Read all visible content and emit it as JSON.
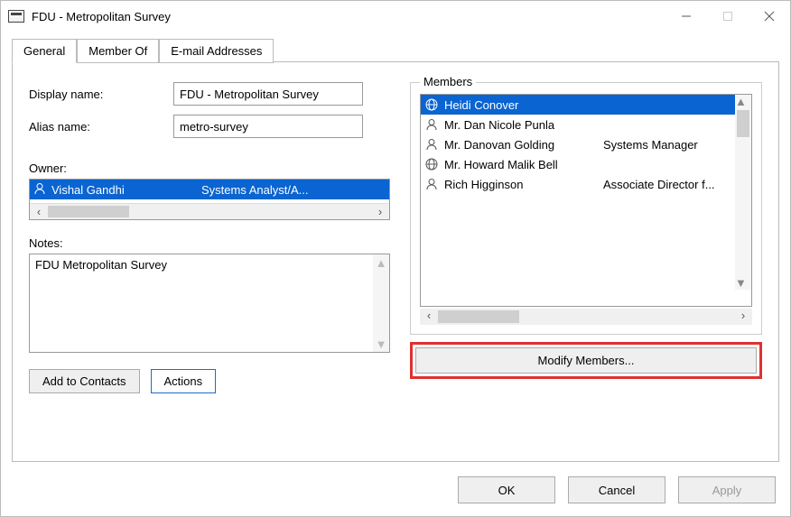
{
  "window": {
    "title": "FDU - Metropolitan Survey"
  },
  "tabs": [
    {
      "label": "General",
      "active": true
    },
    {
      "label": "Member Of",
      "active": false
    },
    {
      "label": "E-mail Addresses",
      "active": false
    }
  ],
  "form": {
    "display_name_label": "Display name:",
    "display_name_value": "FDU - Metropolitan Survey",
    "alias_label": "Alias name:",
    "alias_value": "metro-survey",
    "owner_label": "Owner:",
    "owner": {
      "name": "Vishal Gandhi",
      "title": "Systems Analyst/A..."
    },
    "notes_label": "Notes:",
    "notes_value": "FDU Metropolitan Survey"
  },
  "left_buttons": {
    "add_to_contacts": "Add to Contacts",
    "actions": "Actions"
  },
  "members_group": {
    "title": "Members",
    "modify_label": "Modify Members...",
    "items": [
      {
        "icon": "globe",
        "name": "Heidi Conover",
        "title": "",
        "selected": true
      },
      {
        "icon": "person",
        "name": "Mr. Dan Nicole Punla",
        "title": ""
      },
      {
        "icon": "person",
        "name": "Mr. Danovan Golding",
        "title": "Systems Manager"
      },
      {
        "icon": "globe",
        "name": "Mr. Howard Malik Bell",
        "title": ""
      },
      {
        "icon": "person",
        "name": "Rich Higginson",
        "title": "Associate Director f..."
      }
    ]
  },
  "dialog_buttons": {
    "ok": "OK",
    "cancel": "Cancel",
    "apply": "Apply"
  }
}
